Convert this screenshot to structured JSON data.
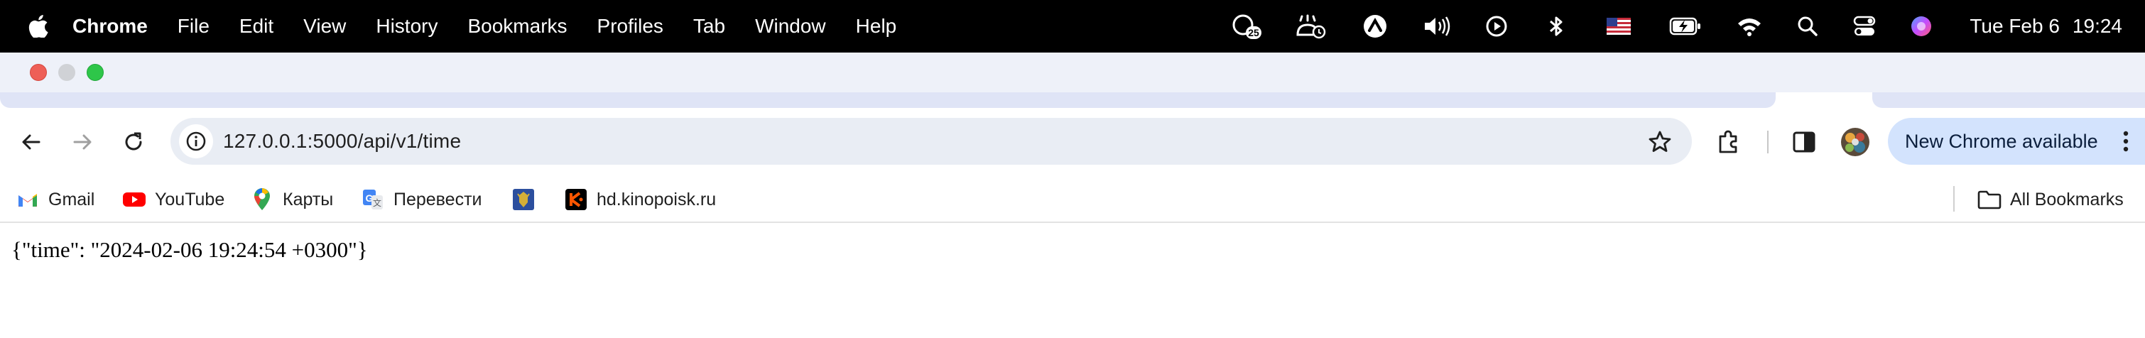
{
  "menubar": {
    "app_name": "Chrome",
    "items": [
      "File",
      "Edit",
      "View",
      "History",
      "Bookmarks",
      "Profiles",
      "Tab",
      "Window",
      "Help"
    ],
    "status_icons": [
      "notification-badge-icon",
      "cloud-sync-icon",
      "vpn-icon",
      "volume-icon",
      "play-icon",
      "bluetooth-icon",
      "us-flag-icon",
      "battery-charging-icon",
      "wifi-icon",
      "spotlight-search-icon",
      "control-center-icon",
      "siri-icon"
    ],
    "badge_count": "25",
    "date": "Tue Feb 6",
    "time": "19:24"
  },
  "toolbar": {
    "url": "127.0.0.1:5000/api/v1/time",
    "update_label": "New Chrome available"
  },
  "bookmarks": {
    "items": [
      {
        "label": "Gmail",
        "icon": "gmail-icon"
      },
      {
        "label": "YouTube",
        "icon": "youtube-icon"
      },
      {
        "label": "Карты",
        "icon": "maps-pin-icon"
      },
      {
        "label": "Перевести",
        "icon": "translate-icon"
      },
      {
        "label": "",
        "icon": "emblem-icon"
      },
      {
        "label": "hd.kinopoisk.ru",
        "icon": "kinopoisk-icon"
      }
    ],
    "all_bookmarks": "All Bookmarks"
  },
  "page": {
    "body_text": "{\"time\": \"2024-02-06 19:24:54 +0300\"}"
  },
  "colors": {
    "menubar_bg": "#000000",
    "omnibox_bg": "#e9edf4",
    "update_pill_bg": "#d3e3fd",
    "close_red": "#ee5f57",
    "zoom_green": "#2ec649"
  }
}
